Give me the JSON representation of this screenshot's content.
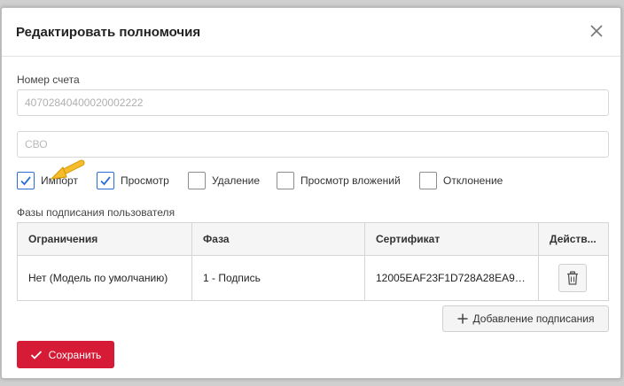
{
  "dialog": {
    "title": "Редактировать полномочия",
    "account_label": "Номер счета",
    "account_value": "40702840400020002222",
    "cbo_placeholder": "СВО"
  },
  "permissions": [
    {
      "label": "Импорт",
      "checked": true
    },
    {
      "label": "Просмотр",
      "checked": true
    },
    {
      "label": "Удаление",
      "checked": false
    },
    {
      "label": "Просмотр вложений",
      "checked": false
    },
    {
      "label": "Отклонение",
      "checked": false
    }
  ],
  "phases_section_label": "Фазы подписания пользователя",
  "table": {
    "headers": [
      "Ограничения",
      "Фаза",
      "Сертификат",
      "Действ..."
    ],
    "rows": [
      {
        "restriction": "Нет (Модель по умолчанию)",
        "phase": "1 - Подпись",
        "certificate": "12005EAF23F1D728A28EA9E3..."
      }
    ]
  },
  "buttons": {
    "add_signature": "Добавление подписания",
    "save": "Сохранить"
  },
  "colors": {
    "accent": "#2a6fd4",
    "save": "#d61b36",
    "arrow": "#f2b21b"
  }
}
